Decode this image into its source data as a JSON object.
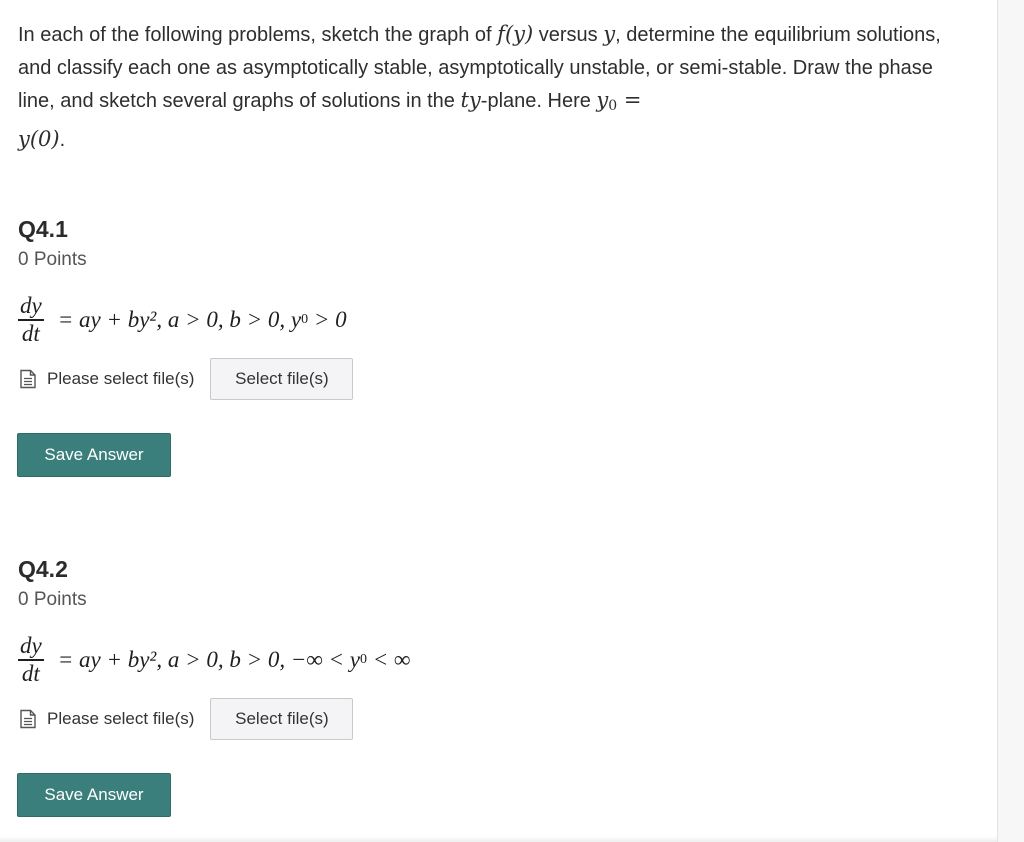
{
  "intro": {
    "part1": "In each of the following problems, sketch the graph of ",
    "fy": "f(y)",
    "part2": " versus ",
    "y": "y",
    "part3": ", determine the equilibrium solutions, and classify each one as asymptotically stable, asymptotically unstable, or semi-stable. Draw the phase line, and sketch several graphs of solutions in the ",
    "ty": "ty",
    "part4": "-plane. Here ",
    "y0": "y",
    "y0_sub": "0",
    "part5": " = ",
    "y_of_0": "y(0)",
    "part6": "."
  },
  "questions": [
    {
      "title": "Q4.1",
      "points": "0 Points",
      "eq_num": "dy",
      "eq_den": "dt",
      "eq_rhs": "= ay + by², a > 0, b > 0, y",
      "eq_sub": "0",
      "eq_tail": " > 0",
      "file_label": "Please select file(s)",
      "select_label": "Select file(s)",
      "save_label": "Save Answer"
    },
    {
      "title": "Q4.2",
      "points": "0 Points",
      "eq_num": "dy",
      "eq_den": "dt",
      "eq_rhs": "= ay + by², a > 0, b > 0, −∞ < y",
      "eq_sub": "0",
      "eq_tail": " < ∞",
      "file_label": "Please select file(s)",
      "select_label": "Select file(s)",
      "save_label": "Save Answer"
    }
  ],
  "colors": {
    "save_button": "#3a7f7b",
    "select_button": "#f4f4f6"
  },
  "icons": {
    "file": "document-icon"
  }
}
